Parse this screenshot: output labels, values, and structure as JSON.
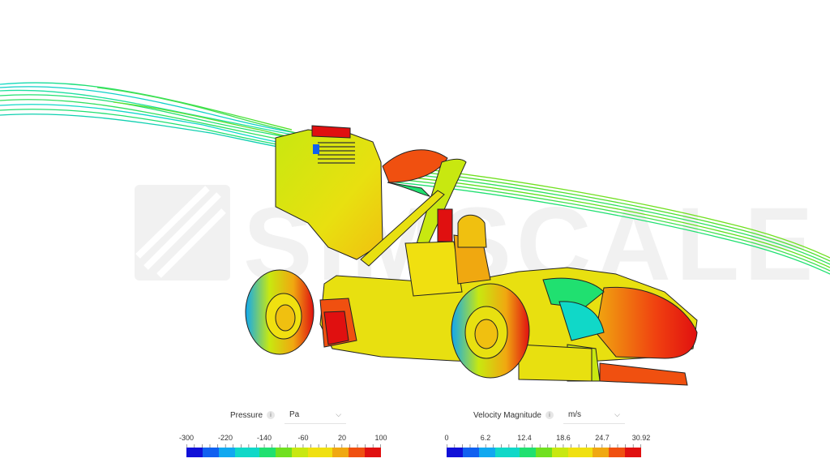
{
  "watermark": "SIMSCALE",
  "pressure_legend": {
    "title": "Pressure",
    "info_icon": "info-icon",
    "unit": "Pa",
    "ticks": [
      "-300",
      "-220",
      "-140",
      "-60",
      "20",
      "100"
    ],
    "range": [
      -300,
      100
    ]
  },
  "velocity_legend": {
    "title": "Velocity Magnitude",
    "info_icon": "info-icon",
    "unit": "m/s",
    "ticks": [
      "0",
      "6.2",
      "12.4",
      "18.6",
      "24.7",
      "30.92"
    ],
    "range": [
      0,
      30.92
    ]
  },
  "colormap": [
    "#1010d8",
    "#1060f0",
    "#10a8f0",
    "#10d8c8",
    "#20e070",
    "#70e020",
    "#c8e810",
    "#f0e010",
    "#f0a810",
    "#f05010",
    "#e01010"
  ]
}
